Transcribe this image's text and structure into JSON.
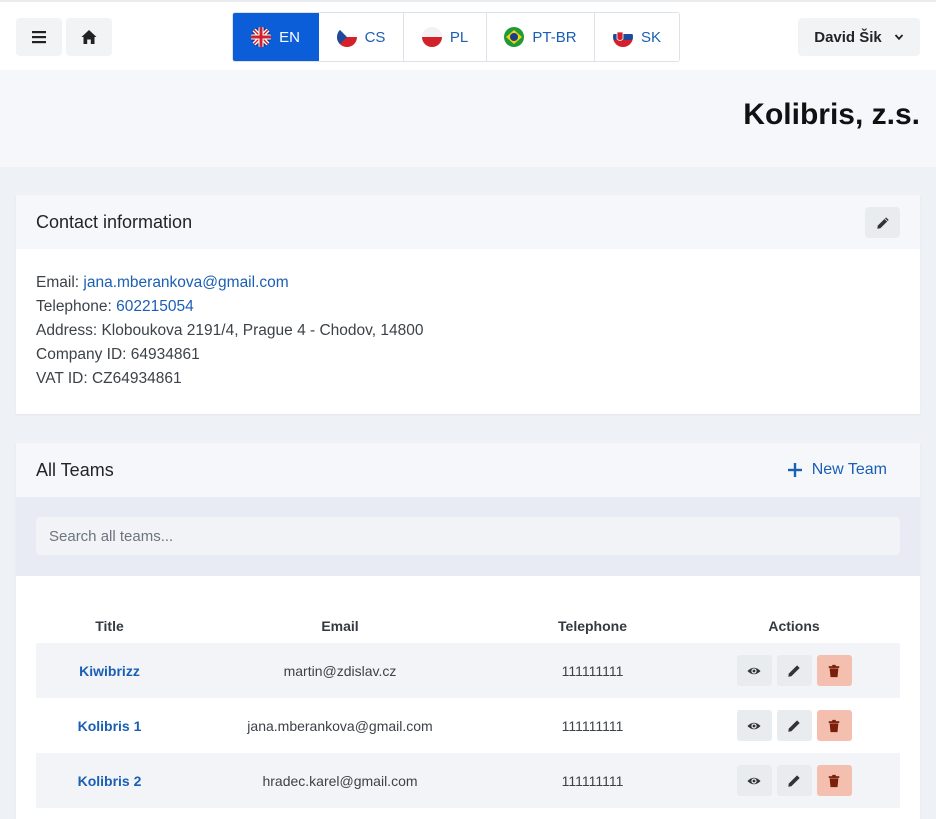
{
  "header": {
    "languages": [
      {
        "code": "EN",
        "flag": "uk-flag-icon",
        "active": true
      },
      {
        "code": "CS",
        "flag": "czech-flag-icon",
        "active": false
      },
      {
        "code": "PL",
        "flag": "poland-flag-icon",
        "active": false
      },
      {
        "code": "PT-BR",
        "flag": "brazil-flag-icon",
        "active": false
      },
      {
        "code": "SK",
        "flag": "slovakia-flag-icon",
        "active": false
      }
    ],
    "user_name": "David Šik",
    "accent": "#0b5ed7"
  },
  "page_title": "Kolibris, z.s.",
  "contact": {
    "title": "Contact information",
    "email_label": "Email:",
    "email": "jana.mberankova@gmail.com",
    "telephone_label": "Telephone:",
    "telephone": "602215054",
    "address": "Address: Kloboukova 2191/4, Prague 4 - Chodov, 14800",
    "company_id": "Company ID: 64934861",
    "vat_id": "VAT ID: CZ64934861"
  },
  "teams": {
    "title": "All Teams",
    "new_team_label": "New Team",
    "search_placeholder": "Search all teams...",
    "columns": [
      "Title",
      "Email",
      "Telephone",
      "Actions"
    ],
    "rows": [
      {
        "title": "Kiwibrizz",
        "email": "martin@zdislav.cz",
        "telephone": "111111111"
      },
      {
        "title": "Kolibris 1",
        "email": "jana.mberankova@gmail.com",
        "telephone": "111111111"
      },
      {
        "title": "Kolibris 2",
        "email": "hradec.karel@gmail.com",
        "telephone": "111111111"
      }
    ]
  }
}
